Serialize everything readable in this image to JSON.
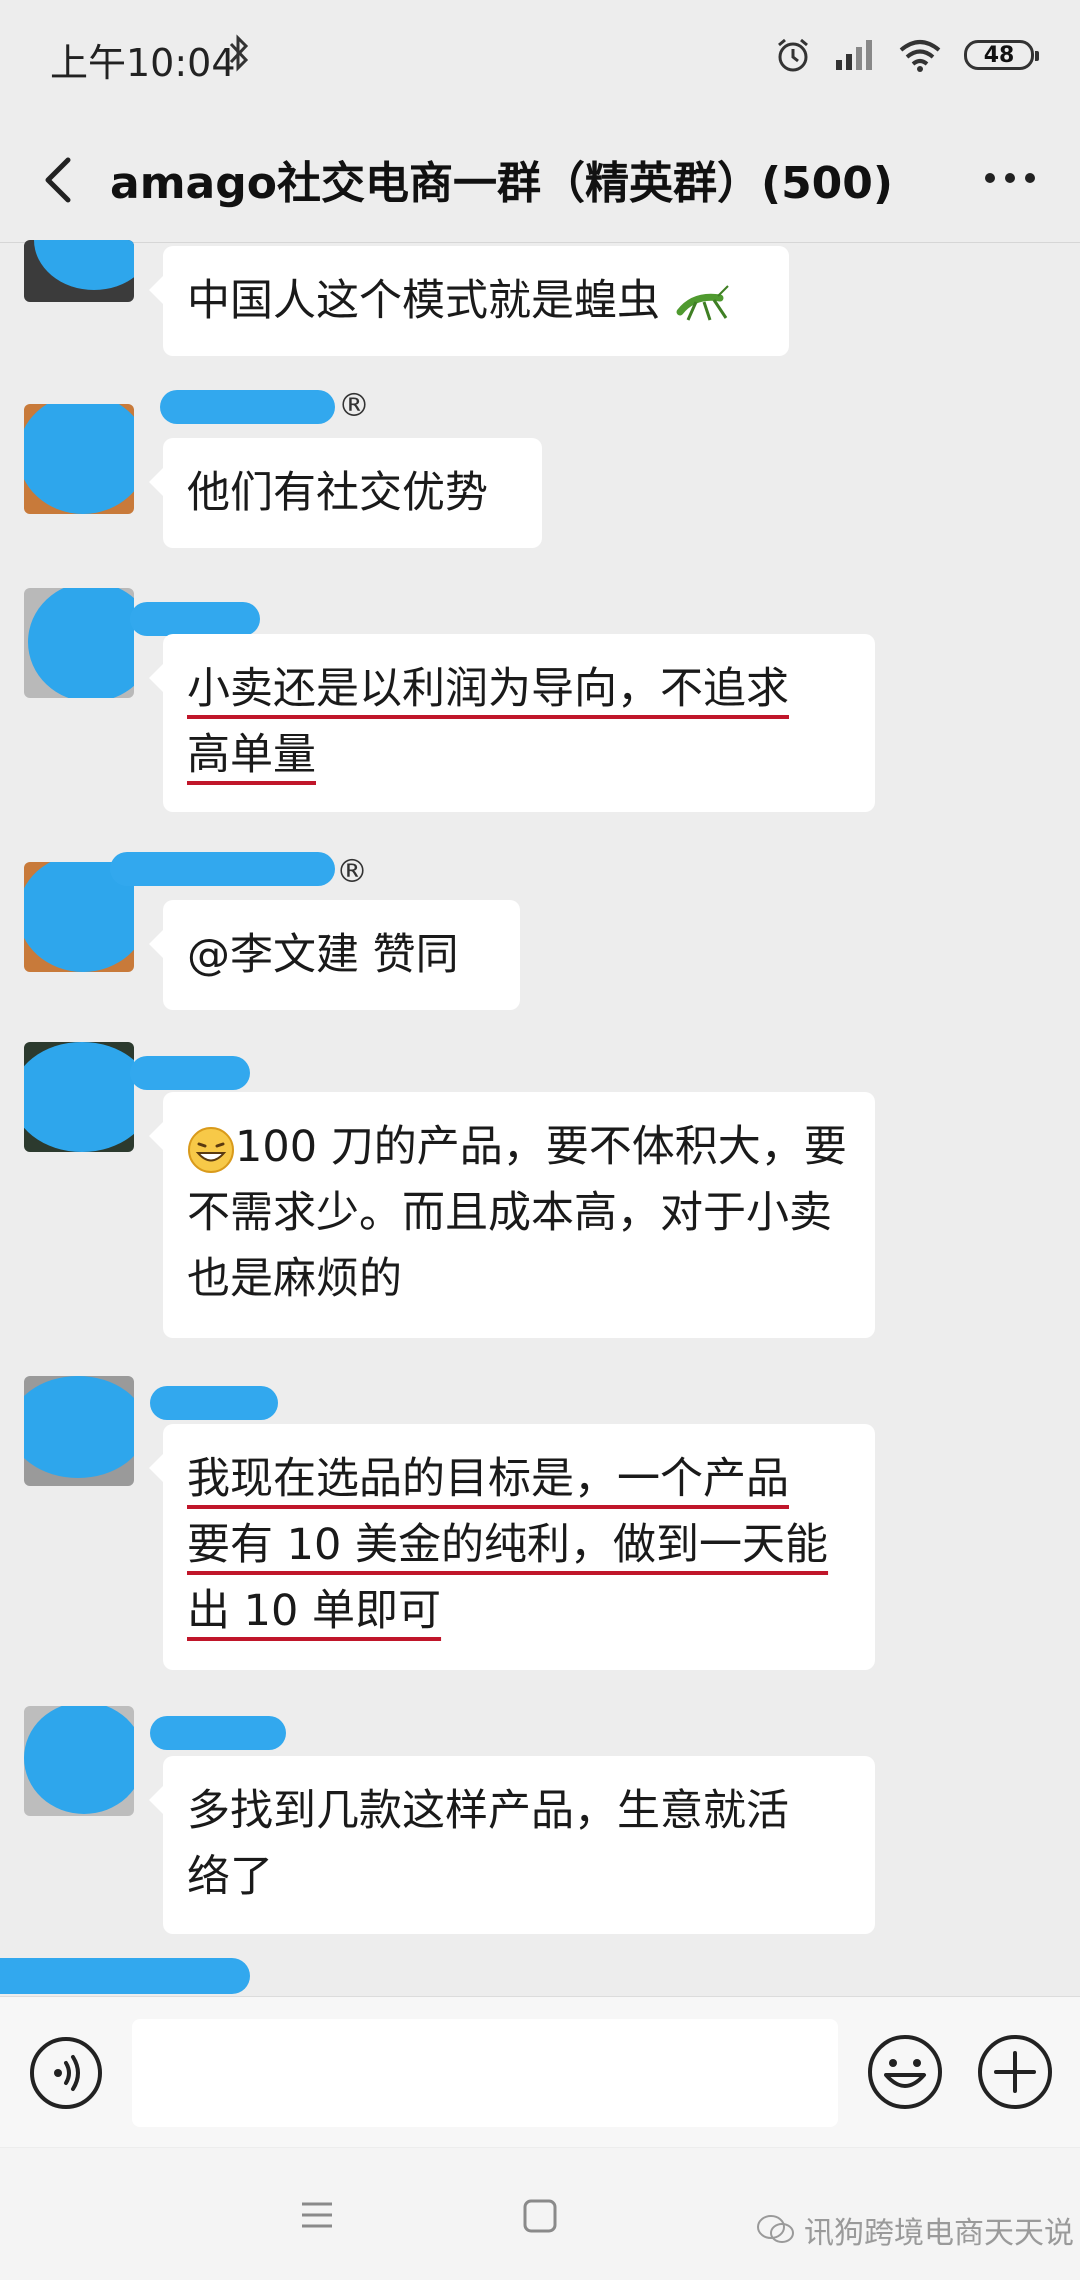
{
  "status_bar": {
    "time": "上午10:04",
    "battery": "48"
  },
  "header": {
    "title": "amago社交电商一群（精英群）(500)"
  },
  "messages": [
    {
      "text": "中国人这个模式就是蝗虫"
    },
    {
      "name_suffix": "®",
      "text": "他们有社交优势"
    },
    {
      "line1": "小卖还是以利润为导向，不追求",
      "line2": "高单量"
    },
    {
      "name_suffix": "®",
      "text": "@李文建  赞同"
    },
    {
      "line1": "100 刀的产品，要不体积大，要",
      "line2": "不需求少。而且成本高，对于小卖",
      "line3": "也是麻烦的"
    },
    {
      "line1": "我现在选品的目标是，一个产品",
      "line2": "要有 10 美金的纯利，做到一天能",
      "line3": "出 10 单即可"
    },
    {
      "line1": "多找到几款这样产品，生意就活",
      "line2": "络了"
    }
  ],
  "watermark": "讯狗跨境电商天天说",
  "icons": {
    "bluetooth": "bluetooth-icon",
    "alarm": "alarm-icon",
    "signal": "signal-icon",
    "wifi": "wifi-icon",
    "back": "chevron-left-icon",
    "more": "more-icon",
    "grasshopper": "grasshopper-emoji",
    "grin": "grin-emoji",
    "voice": "voice-icon",
    "emoji": "smiley-icon",
    "plus": "plus-icon"
  },
  "colors": {
    "background": "#ededed",
    "bubble": "#ffffff",
    "underline": "#c0162a",
    "blur": "#2ea6ec"
  }
}
